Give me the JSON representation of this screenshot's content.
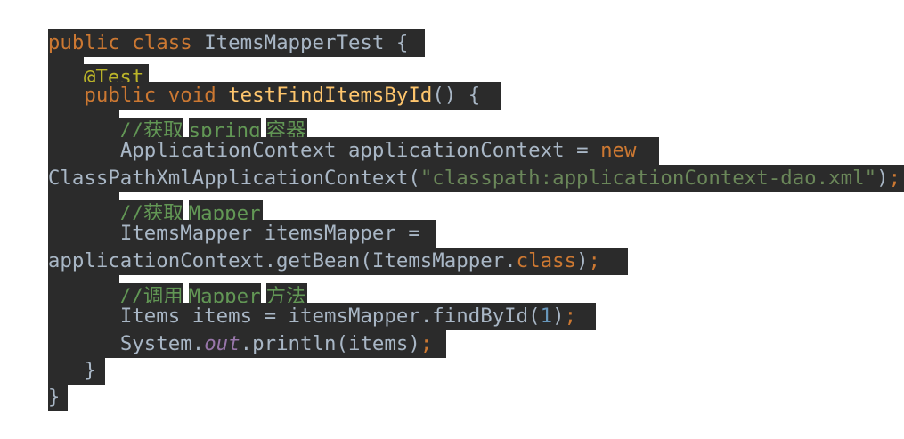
{
  "lines": [
    {
      "text": "public class ItemsMapperTest {"
    },
    {
      "text": "@Test"
    },
    {
      "text": "public void testFindItemsById() {"
    },
    {
      "text": "//获取spring容器"
    },
    {
      "text": "ApplicationContext applicationContext = new"
    },
    {
      "text": "ClassPathXmlApplicationContext(\"classpath:applicationContext-dao.xml\");"
    },
    {
      "text": "//获取Mapper"
    },
    {
      "text": "ItemsMapper itemsMapper ="
    },
    {
      "text": "applicationContext.getBean(ItemsMapper.class);"
    },
    {
      "text": "//调用Mapper方法"
    },
    {
      "text": "Items items = itemsMapper.findById(1);"
    },
    {
      "text": "System.out.println(items);"
    },
    {
      "text": "}"
    },
    {
      "text": "}"
    }
  ],
  "tokens": {
    "l1_public": "public",
    "l1_class": "class",
    "l1_name": "ItemsMapperTest",
    "l1_brace": "{",
    "l2_ann": "@Test",
    "l3_public": "public",
    "l3_void": "void",
    "l3_method": "testFindItemsById",
    "l3_parens": "()",
    "l3_brace": "{",
    "l4_slashes": "//",
    "l4_cn1": "获取",
    "l4_spring": "spring",
    "l4_cn2": "容器",
    "l5_type": "ApplicationContext",
    "l5_var": "applicationContext",
    "l5_eq": "=",
    "l5_new": "new",
    "l6_class": "ClassPathXmlApplicationContext(",
    "l6_str": "\"classpath:applicationContext-dao.xml\"",
    "l6_close": ")",
    "l6_semi": ";",
    "l7_slashes": "//",
    "l7_cn": "获取",
    "l7_mapper": "Mapper",
    "l8_type": "ItemsMapper",
    "l8_var": "itemsMapper",
    "l8_eq": "=",
    "l9_call": "applicationContext.getBean(ItemsMapper.",
    "l9_class": "class",
    "l9_close": ")",
    "l9_semi": ";",
    "l10_slashes": "//",
    "l10_cn1": "调用",
    "l10_mapper": "Mapper",
    "l10_cn2": "方法",
    "l11_code": "Items items = itemsMapper.findById(",
    "l11_num": "1",
    "l11_close": ")",
    "l11_semi": ";",
    "l12_sys": "System.",
    "l12_out": "out",
    "l12_rest": ".println(items)",
    "l12_semi": ";",
    "l13_brace": "}",
    "l14_brace": "}"
  },
  "colors": {
    "background_bar": "#2b2b2b",
    "default_text": "#a9b7c6",
    "keyword": "#cc7832",
    "annotation": "#bbb529",
    "method_name": "#ffc66d",
    "comment": "#629755",
    "string": "#6a8759",
    "number": "#6897bb",
    "static_field": "#9876aa"
  }
}
